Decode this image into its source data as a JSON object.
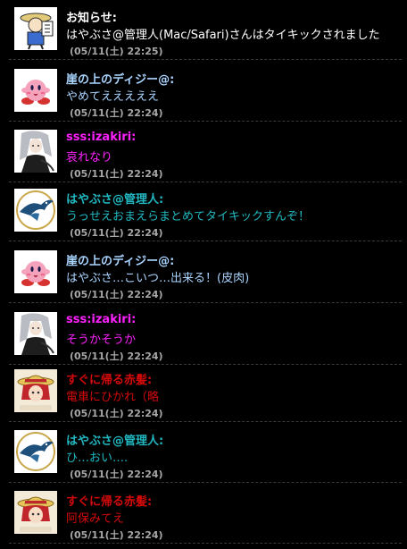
{
  "messages": [
    {
      "kind": "system",
      "avatar": "notice-icon",
      "name": "お知らせ:",
      "text": "はやぶさ@管理人(Mac/Safari)さんはタイキックされました",
      "time": "(05/11(土) 22:25)"
    },
    {
      "kind": "daisy",
      "avatar": "pink-puffball-avatar",
      "name": "崖の上のディジー@:",
      "text": "やめてえええええ",
      "time": "(05/11(土) 22:24)"
    },
    {
      "kind": "izakiri",
      "avatar": "silver-hair-character-avatar",
      "name": "sss:izakiri:",
      "text": "哀れなり",
      "time": "(05/11(土) 22:24)"
    },
    {
      "kind": "admin",
      "avatar": "falcon-logo-avatar",
      "name": "はやぶさ@管理人:",
      "text": "うっせえおまえらまとめてタイキックすんぞ！",
      "time": "(05/11(土) 22:24)"
    },
    {
      "kind": "daisy",
      "avatar": "pink-puffball-avatar",
      "name": "崖の上のディジー@:",
      "text": "はやぶさ…こいつ…出来る！(皮肉)",
      "time": "(05/11(土) 22:24)"
    },
    {
      "kind": "izakiri",
      "avatar": "silver-hair-character-avatar",
      "name": "sss:izakiri:",
      "text": "そうかそうか",
      "time": "(05/11(土) 22:24)"
    },
    {
      "kind": "red",
      "avatar": "straw-hat-character-avatar",
      "name": "すぐに帰る赤髪:",
      "text": "電車にひかれ（略",
      "time": "(05/11(土) 22:24)"
    },
    {
      "kind": "admin",
      "avatar": "falcon-logo-avatar",
      "name": "はやぶさ@管理人:",
      "text": "ひ…おい….",
      "time": "(05/11(土) 22:24)"
    },
    {
      "kind": "red",
      "avatar": "straw-hat-character-avatar",
      "name": "すぐに帰る赤髪:",
      "text": "阿保みてえ",
      "time": "(05/11(土) 22:24)"
    }
  ],
  "colors": {
    "system": "#ffffff",
    "daisy": "#a9d4ff",
    "izakiri": "#ff22ff",
    "admin": "#21b8c2",
    "red": "#d40a0a",
    "time": "#a7a7a7",
    "background": "#000000"
  }
}
